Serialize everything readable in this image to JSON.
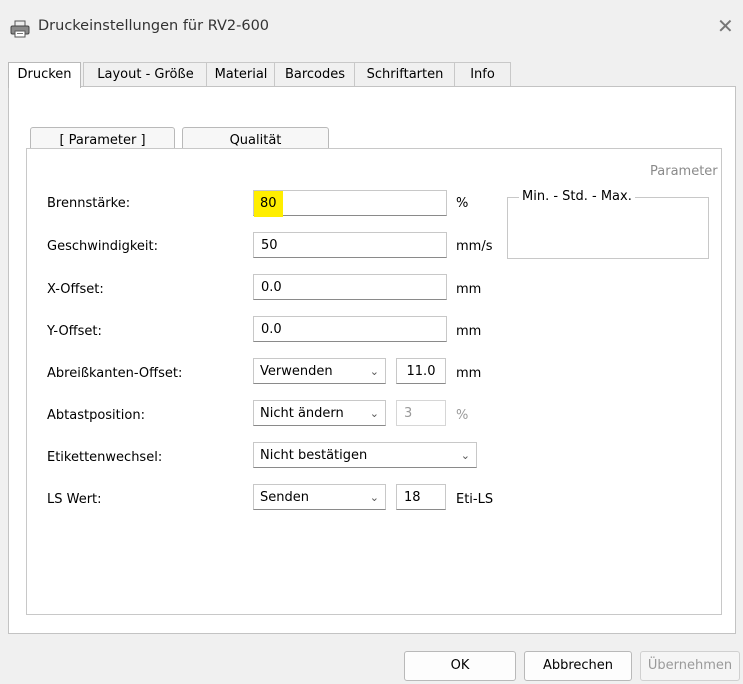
{
  "window": {
    "title": "Druckeinstellungen für RV2-600",
    "close_glyph": "✕",
    "icon": "printer-icon"
  },
  "tabs": [
    {
      "label": "Drucken",
      "active": true
    },
    {
      "label": "Layout - Größe"
    },
    {
      "label": "Material"
    },
    {
      "label": "Barcodes"
    },
    {
      "label": "Schriftarten"
    },
    {
      "label": "Info"
    }
  ],
  "subtabs": {
    "parameter": "[ Parameter ]",
    "qualitaet": "Qualität"
  },
  "parameter_group": {
    "title": "Parameter",
    "legend": "Min.  -  Std.  -  Max."
  },
  "fields": {
    "brennstaerke": {
      "label": "Brennstärke:",
      "value": "80",
      "unit": "%"
    },
    "geschwindigkeit": {
      "label": "Geschwindigkeit:",
      "value": "50",
      "unit": "mm/s"
    },
    "x_offset": {
      "label": "X-Offset:",
      "value": "0.0",
      "unit": "mm"
    },
    "y_offset": {
      "label": "Y-Offset:",
      "value": "0.0",
      "unit": "mm"
    },
    "abreisskanten": {
      "label": "Abreißkanten-Offset:",
      "select": "Verwenden",
      "value": "11.0",
      "unit": "mm"
    },
    "abtastposition": {
      "label": "Abtastposition:",
      "select": "Nicht ändern",
      "value": "3",
      "unit": "%"
    },
    "etikettenwechsel": {
      "label": "Etikettenwechsel:",
      "select": "Nicht bestätigen"
    },
    "ls_wert": {
      "label": "LS Wert:",
      "select": "Senden",
      "value": "18",
      "unit": "Eti-LS"
    }
  },
  "buttons": {
    "ok": "OK",
    "abbrechen": "Abbrechen",
    "uebernehmen": "Übernehmen"
  },
  "colors": {
    "highlight": "#ffee00"
  }
}
